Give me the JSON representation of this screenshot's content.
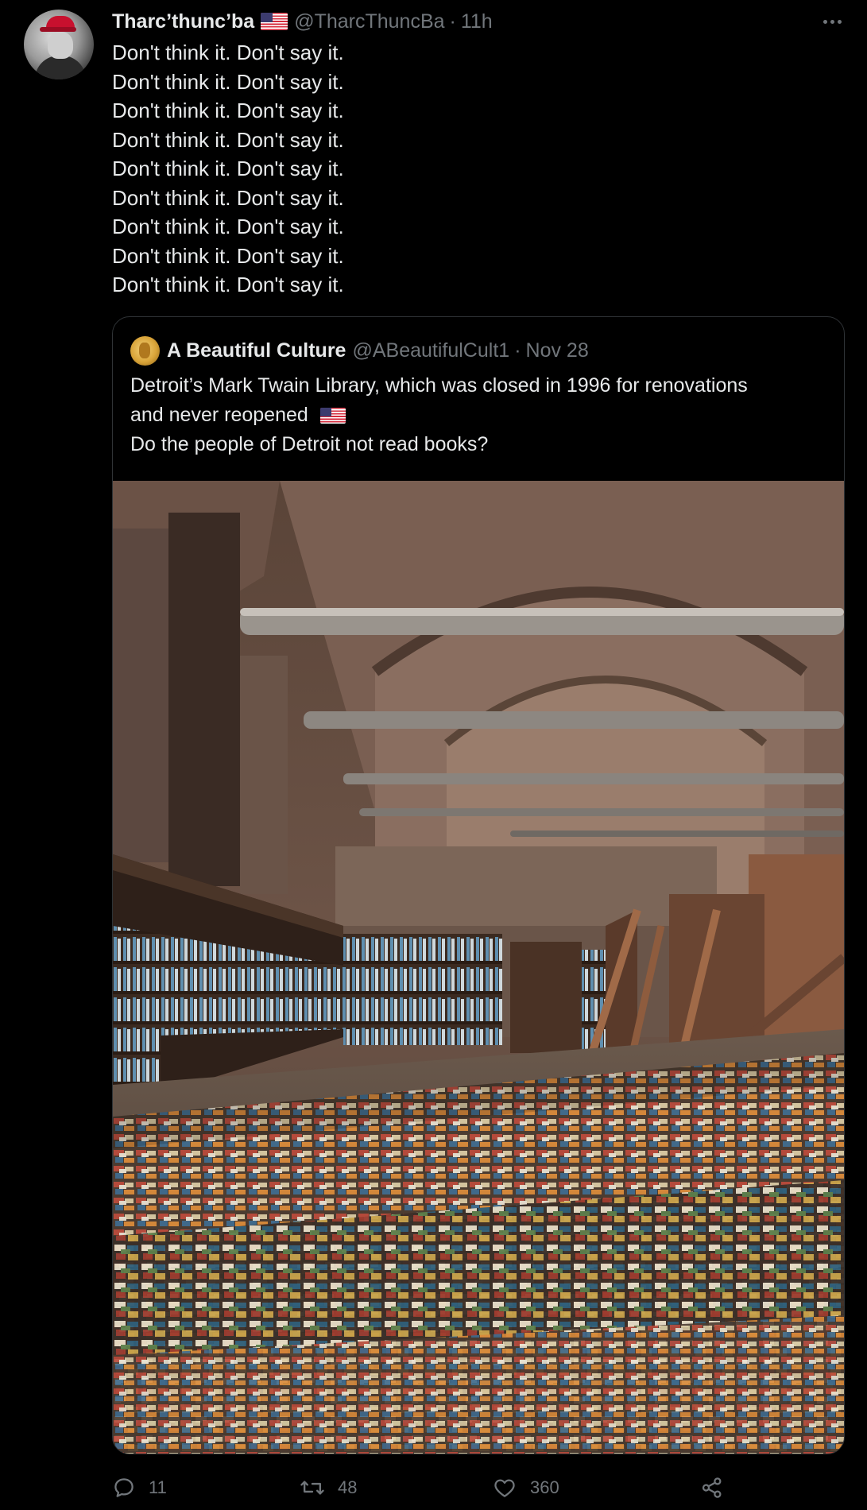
{
  "tweet": {
    "display_name": "Tharc’thunc’ba",
    "handle": "@TharcThuncBa",
    "separator": "·",
    "time": "11h",
    "body_lines": [
      "Don't think it. Don't say it.",
      "Don't think it. Don't say it.",
      "Don't think it. Don't say it.",
      "Don't think it. Don't say it.",
      "Don't think it. Don't say it.",
      "Don't think it. Don't say it.",
      "Don't think it. Don't say it.",
      "Don't think it. Don't say it.",
      "Don't think it. Don't say it."
    ]
  },
  "quote": {
    "display_name": "A Beautiful Culture",
    "handle": "@ABeautifulCult1",
    "separator": "·",
    "date": "Nov 28",
    "text_line1": "Detroit’s Mark Twain Library, which was closed in 1996 for renovations",
    "text_line2": "and never reopened",
    "text_line3": "Do the people of Detroit not read books?"
  },
  "actions": {
    "reply_count": "11",
    "retweet_count": "48",
    "like_count": "360"
  },
  "icons": {
    "more": "more-horizontal-icon",
    "reply": "reply-icon",
    "retweet": "retweet-icon",
    "like": "heart-icon",
    "share": "share-icon",
    "flag": "us-flag-icon"
  },
  "colors": {
    "background": "#000000",
    "text_primary": "#e7e9ea",
    "text_secondary": "#71767b",
    "border": "#2f3336"
  }
}
